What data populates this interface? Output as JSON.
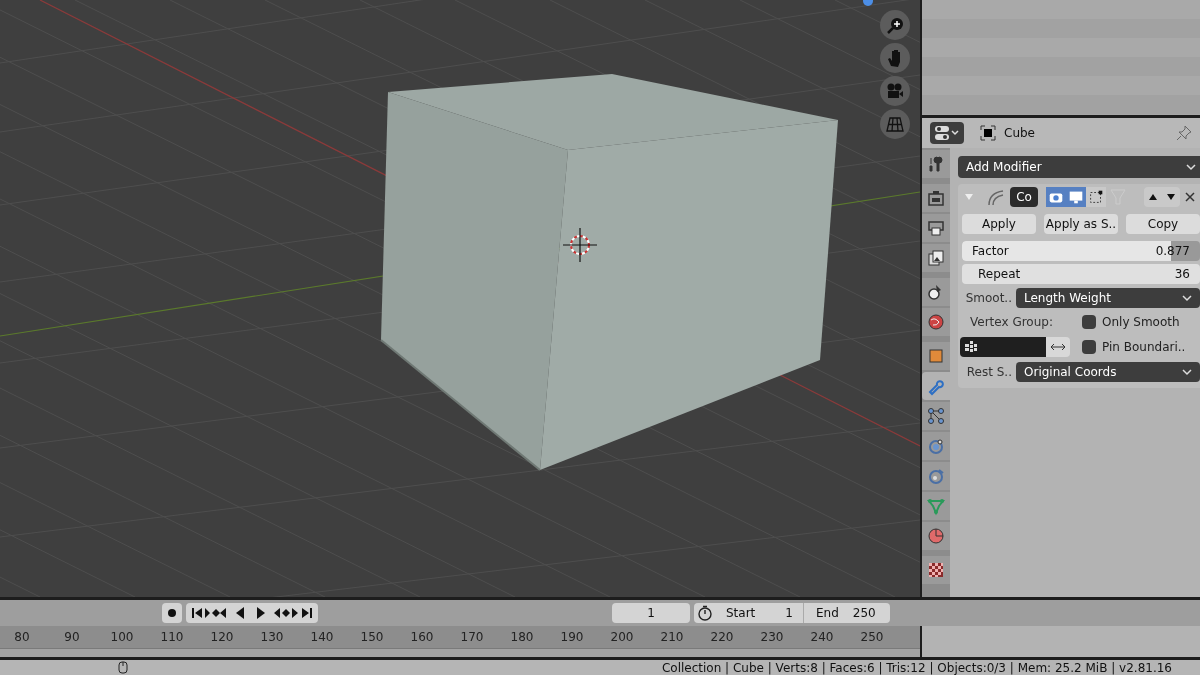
{
  "viewport": {
    "nav_tools": [
      {
        "kind": "zoom"
      },
      {
        "kind": "pan"
      },
      {
        "kind": "camera"
      },
      {
        "kind": "ortho"
      }
    ]
  },
  "properties": {
    "object_name": "Cube",
    "tabs": [
      {
        "kind": "tool",
        "selected": false
      },
      {
        "kind": "render",
        "selected": false
      },
      {
        "kind": "output",
        "selected": false
      },
      {
        "kind": "view_layer",
        "selected": false
      },
      {
        "kind": "scene",
        "selected": false
      },
      {
        "kind": "world",
        "selected": false
      },
      {
        "kind": "object",
        "selected": false
      },
      {
        "kind": "modifiers",
        "selected": true
      },
      {
        "kind": "particles",
        "selected": false
      },
      {
        "kind": "physics",
        "selected": false
      },
      {
        "kind": "constraints",
        "selected": false
      },
      {
        "kind": "data",
        "selected": false
      },
      {
        "kind": "material",
        "selected": false
      },
      {
        "kind": "texture",
        "selected": false
      }
    ],
    "add_modifier": "Add Modifier",
    "modifier": {
      "expanded": true,
      "name": "Co",
      "show_render": true,
      "show_viewport": true,
      "show_cage": false,
      "buttons": [
        "Apply",
        "Apply as S..",
        "Copy"
      ],
      "factor": {
        "label": "Factor",
        "value": "0.877",
        "level": 0.877
      },
      "repeat": {
        "label": "Repeat",
        "value": "36"
      },
      "smooth": {
        "label": "Smoot..",
        "value": "Length Weight"
      },
      "vertex_group": {
        "label": "Vertex Group:"
      },
      "only_smooth": {
        "label": "Only Smooth",
        "checked": false
      },
      "pin_boundary": {
        "label": "Pin Boundari..",
        "checked": false
      },
      "rest": {
        "label": "Rest S..",
        "value": "Original Coords"
      }
    }
  },
  "timeline": {
    "current_frame": "1",
    "start_label": "Start",
    "start": "1",
    "end_label": "End",
    "end": "250",
    "ruler": [
      "80",
      "90",
      "100",
      "110",
      "120",
      "130",
      "140",
      "150",
      "160",
      "170",
      "180",
      "190",
      "200",
      "210",
      "220",
      "230",
      "240",
      "250"
    ]
  },
  "status_bar": "Collection | Cube | Verts:8 | Faces:6 | Tris:12 | Objects:0/3 | Mem: 25.2 MiB | v2.81.16"
}
